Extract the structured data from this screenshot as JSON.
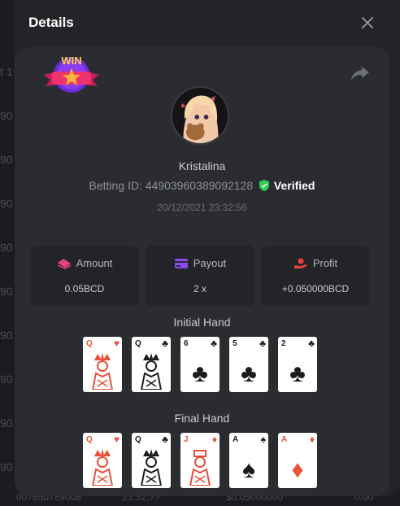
{
  "background": {
    "side_numbers": [
      "t 1",
      "90",
      "90",
      "90",
      "90",
      "90",
      "90",
      "90",
      "90",
      "90",
      "90"
    ],
    "bottom_row": [
      "007850789008",
      "23:32:??",
      "$0.05000000",
      "0.00"
    ]
  },
  "modal": {
    "title": "Details",
    "close_icon": "close-icon"
  },
  "bet": {
    "badge": "WIN",
    "username": "Kristalina",
    "betting_id_label": "Betting ID: 44903960389092128",
    "verified_label": "Verified",
    "datetime": "20/12/2021 23:32:56"
  },
  "stats": [
    {
      "label": "Amount",
      "value": "0.05BCD",
      "icon": "amount-icon",
      "color": "#e0457b"
    },
    {
      "label": "Payout",
      "value": "2 x",
      "icon": "payout-icon",
      "color": "#8b47f0"
    },
    {
      "label": "Profit",
      "value": "+0.050000BCD",
      "icon": "profit-icon",
      "color": "#e8433f"
    }
  ],
  "initial_hand": {
    "title": "Initial Hand",
    "cards": [
      {
        "rank": "Q",
        "suit": "♥",
        "color": "red"
      },
      {
        "rank": "Q",
        "suit": "♣",
        "color": "black"
      },
      {
        "rank": "6",
        "suit": "♣",
        "color": "black"
      },
      {
        "rank": "5",
        "suit": "♣",
        "color": "black"
      },
      {
        "rank": "2",
        "suit": "♣",
        "color": "black"
      }
    ]
  },
  "final_hand": {
    "title": "Final Hand",
    "cards": [
      {
        "rank": "Q",
        "suit": "♥",
        "color": "red"
      },
      {
        "rank": "Q",
        "suit": "♣",
        "color": "black"
      },
      {
        "rank": "J",
        "suit": "♦",
        "color": "red"
      },
      {
        "rank": "A",
        "suit": "♠",
        "color": "black"
      },
      {
        "rank": "A",
        "suit": "♦",
        "color": "red"
      }
    ]
  },
  "colors": {
    "accent_green": "#2ecc55",
    "panel": "#2b2c31",
    "modal": "#232427"
  }
}
